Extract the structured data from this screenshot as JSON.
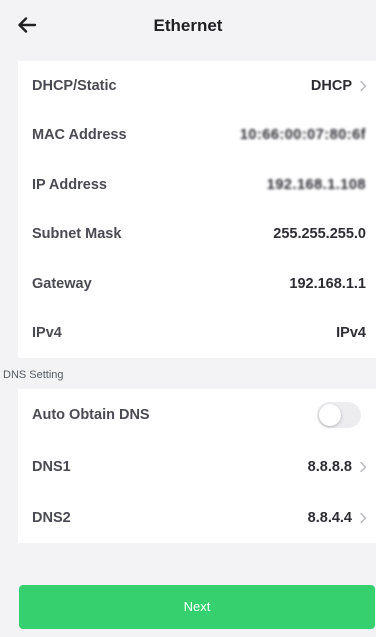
{
  "header": {
    "title": "Ethernet",
    "back_icon": "arrow-left-icon"
  },
  "network": {
    "rows": [
      {
        "label": "DHCP/Static",
        "value": "DHCP",
        "chevron": true,
        "blurred": false
      },
      {
        "label": "MAC Address",
        "value": "10:66:00:07:80:6f",
        "chevron": false,
        "blurred": true
      },
      {
        "label": "IP Address",
        "value": "192.168.1.108",
        "chevron": false,
        "blurred": true
      },
      {
        "label": "Subnet Mask",
        "value": "255.255.255.0",
        "chevron": false,
        "blurred": false
      },
      {
        "label": "Gateway",
        "value": "192.168.1.1",
        "chevron": false,
        "blurred": false
      },
      {
        "label": "IPv4",
        "value": "IPv4",
        "chevron": false,
        "blurred": false
      }
    ]
  },
  "dns": {
    "section_label": "DNS Setting",
    "auto_obtain": {
      "label": "Auto Obtain DNS",
      "enabled": false
    },
    "dns1": {
      "label": "DNS1",
      "value": "8.8.8.8"
    },
    "dns2": {
      "label": "DNS2",
      "value": "8.8.4.4"
    }
  },
  "footer": {
    "next_label": "Next"
  },
  "colors": {
    "accent": "#36d06f",
    "background": "#f3f3f5",
    "card": "#ffffff"
  }
}
